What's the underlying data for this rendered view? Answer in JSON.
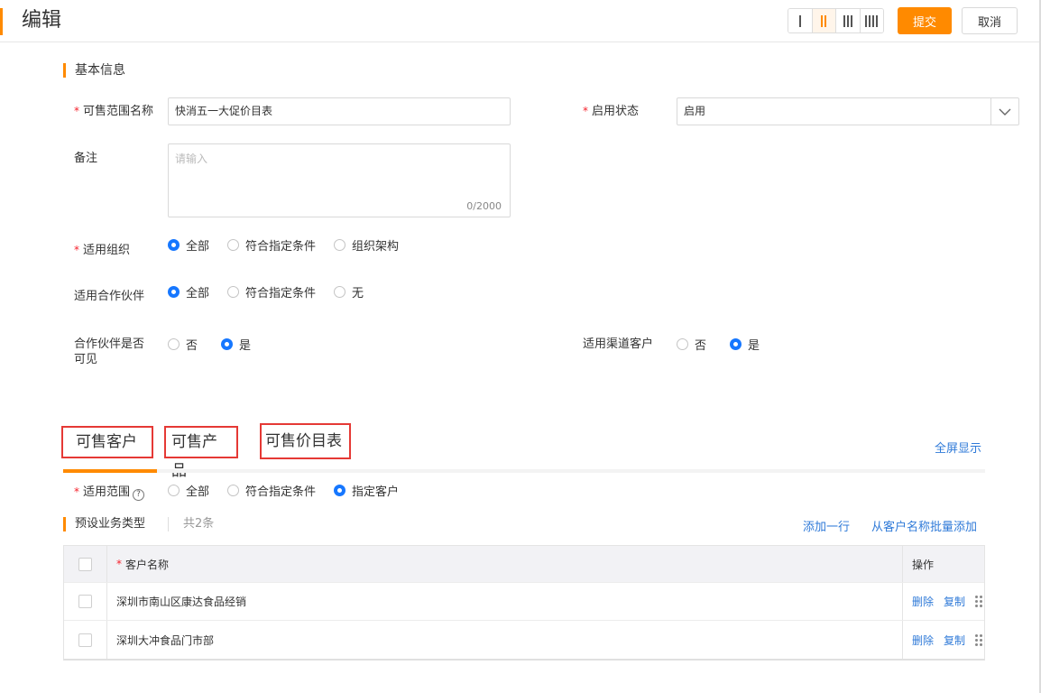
{
  "header": {
    "title": "编辑",
    "submit_label": "提交",
    "cancel_label": "取消",
    "layout_options": [
      1,
      2,
      3,
      4
    ],
    "active_layout": 2
  },
  "basic_info": {
    "section_title": "基本信息",
    "scope_name": {
      "label": "可售范围名称",
      "required": "*",
      "value": "快消五一大促价目表"
    },
    "status": {
      "label": "启用状态",
      "required": "*",
      "value": "启用"
    },
    "remark": {
      "label": "备注",
      "placeholder": "请输入",
      "counter": "0/2000"
    },
    "org": {
      "label": "适用组织",
      "required": "*",
      "options": [
        "全部",
        "符合指定条件",
        "组织架构"
      ],
      "selected": "全部"
    },
    "partner": {
      "label": "适用合作伙伴",
      "options": [
        "全部",
        "符合指定条件",
        "无"
      ],
      "selected": "全部"
    },
    "partner_visible": {
      "label_line1": "合作伙伴是否",
      "label_line2": "可见",
      "options": [
        "否",
        "是"
      ],
      "selected": "是"
    },
    "channel_customer": {
      "label": "适用渠道客户",
      "options": [
        "否",
        "是"
      ],
      "selected": "是"
    }
  },
  "tabs": {
    "items": [
      "可售客户",
      "可售产品",
      "可售价目表"
    ],
    "active": "可售客户",
    "fullscreen_label": "全屏显示"
  },
  "customer_tab": {
    "scope": {
      "label": "适用范围",
      "required": "*",
      "options": [
        "全部",
        "符合指定条件",
        "指定客户"
      ],
      "selected": "指定客户"
    },
    "sub_title": "预设业务类型",
    "count": "共2条",
    "add_row_label": "添加一行",
    "batch_add_label": "从客户名称批量添加",
    "table": {
      "headers": {
        "name": "客户名称",
        "name_required": "*",
        "ops": "操作"
      },
      "rows": [
        {
          "name": "深圳市南山区康达食品经销",
          "delete": "删除",
          "copy": "复制"
        },
        {
          "name": "深圳大冲食品门市部",
          "delete": "删除",
          "copy": "复制"
        }
      ]
    }
  },
  "colors": {
    "accent": "#ff8a00",
    "link": "#2f7ad8",
    "radio_on": "#1677ff",
    "required": "#f5222d",
    "tab_highlight_border": "#e53935"
  },
  "icons": {
    "status_dropdown": "chevron-down-icon",
    "scope_help": "question-circle-icon",
    "row_drag": "drag-handle-icon"
  }
}
